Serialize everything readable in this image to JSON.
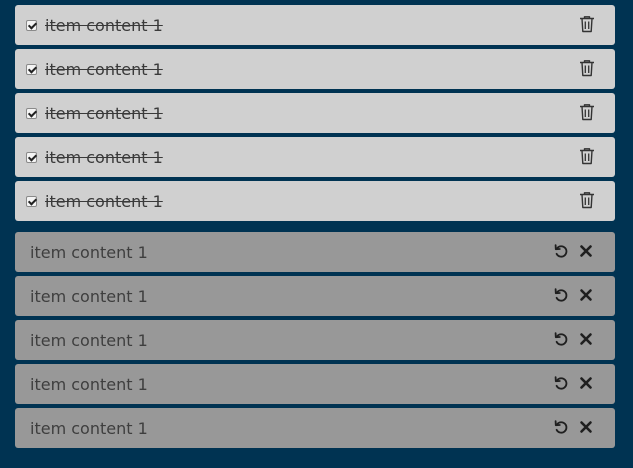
{
  "active_items": [
    {
      "label": "item content 1",
      "checked": true
    },
    {
      "label": "item content 1",
      "checked": true
    },
    {
      "label": "item content 1",
      "checked": true
    },
    {
      "label": "item content 1",
      "checked": true
    },
    {
      "label": "item content 1",
      "checked": true
    }
  ],
  "trashed_items": [
    {
      "label": "item content 1"
    },
    {
      "label": "item content 1"
    },
    {
      "label": "item content 1"
    },
    {
      "label": "item content 1"
    },
    {
      "label": "item content 1"
    }
  ],
  "icons": {
    "active_action": "trash-icon",
    "trashed_actions": [
      "restore-icon",
      "delete-icon"
    ]
  },
  "colors": {
    "background": "#003352",
    "active_item_bg": "#d0d0d0",
    "trashed_item_bg": "#989898"
  }
}
